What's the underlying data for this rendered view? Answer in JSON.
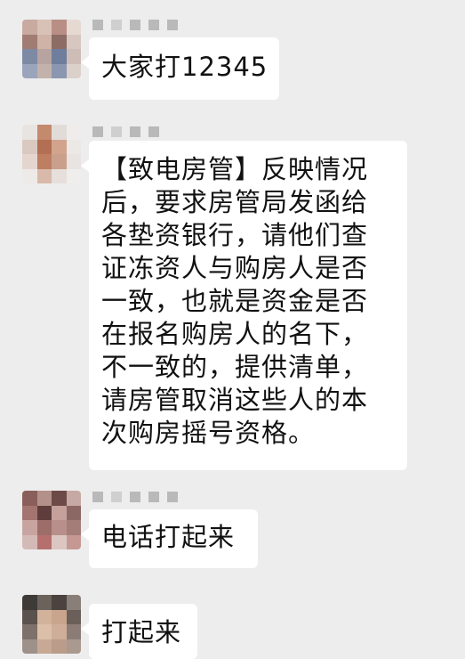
{
  "chat": {
    "messages": [
      {
        "text": "大家打12345"
      },
      {
        "lines": [
          "【致电房管】反映情况",
          "后，要求房管局发函给",
          "各垫资银行，请他们查",
          "证冻资人与购房人是否",
          "一致，也就是资金是否",
          "在报名购房人的名下，",
          "不一致的，提供清单，",
          "请房管取消这些人的本",
          "次购房摇号资格。"
        ]
      },
      {
        "text": "电话打起来"
      },
      {
        "text": "打起来"
      }
    ]
  }
}
